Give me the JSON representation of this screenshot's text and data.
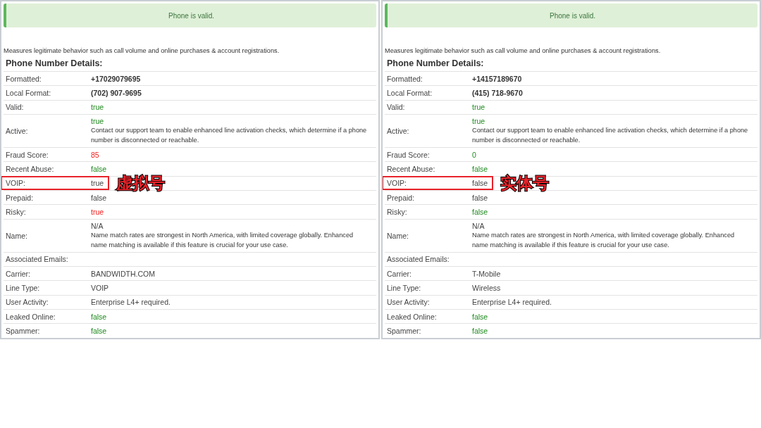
{
  "panels": [
    {
      "alert": "Phone is valid.",
      "description": "Measures legitimate behavior such as call volume and online purchases & account registrations.",
      "heading": "Phone Number Details:",
      "rows": [
        {
          "label": "Formatted:",
          "value": "+17029079695",
          "kind": "strong",
          "highlighted": false
        },
        {
          "label": "Local Format:",
          "value": "(702) 907-9695",
          "kind": "strong",
          "highlighted": false
        },
        {
          "label": "Valid:",
          "value": "true",
          "kind": "good",
          "highlighted": false
        },
        {
          "label": "Active:",
          "value": "true",
          "kind": "good",
          "note": "Contact our support team to enable enhanced line activation checks, which determine if a phone number is disconnected or reachable.",
          "highlighted": false
        },
        {
          "label": "Fraud Score:",
          "value": "85",
          "kind": "bad",
          "highlighted": false
        },
        {
          "label": "Recent Abuse:",
          "value": "false",
          "kind": "good",
          "highlighted": false
        },
        {
          "label": "VOIP:",
          "value": "true",
          "kind": "plain",
          "highlighted": true,
          "callout": "虚拟号"
        },
        {
          "label": "Prepaid:",
          "value": "false",
          "kind": "plain",
          "highlighted": false
        },
        {
          "label": "Risky:",
          "value": "true",
          "kind": "bad",
          "highlighted": false
        },
        {
          "label": "Name:",
          "value": "N/A",
          "kind": "plain",
          "note": "Name match rates are strongest in North America, with limited coverage globally. Enhanced name matching is available if this feature is crucial for your use case.",
          "highlighted": false
        },
        {
          "label": "Associated Emails:",
          "highlighted": false
        },
        {
          "label": "Carrier:",
          "value": "BANDWIDTH.COM",
          "kind": "plain",
          "highlighted": false
        },
        {
          "label": "Line Type:",
          "value": "VOIP",
          "kind": "plain",
          "highlighted": false
        },
        {
          "label": "User Activity:",
          "value": "Enterprise L4+ required.",
          "kind": "plain",
          "highlighted": false
        },
        {
          "label": "Leaked Online:",
          "value": "false",
          "kind": "good",
          "highlighted": false
        },
        {
          "label": "Spammer:",
          "value": "false",
          "kind": "good",
          "highlighted": false
        }
      ]
    },
    {
      "alert": "Phone is valid.",
      "description": "Measures legitimate behavior such as call volume and online purchases & account registrations.",
      "heading": "Phone Number Details:",
      "rows": [
        {
          "label": "Formatted:",
          "value": "+14157189670",
          "kind": "strong",
          "highlighted": false
        },
        {
          "label": "Local Format:",
          "value": "(415) 718-9670",
          "kind": "strong",
          "highlighted": false
        },
        {
          "label": "Valid:",
          "value": "true",
          "kind": "good",
          "highlighted": false
        },
        {
          "label": "Active:",
          "value": "true",
          "kind": "good",
          "note": "Contact our support team to enable enhanced line activation checks, which determine if a phone number is disconnected or reachable.",
          "highlighted": false
        },
        {
          "label": "Fraud Score:",
          "value": "0",
          "kind": "good",
          "highlighted": false
        },
        {
          "label": "Recent Abuse:",
          "value": "false",
          "kind": "good",
          "highlighted": false
        },
        {
          "label": "VOIP:",
          "value": "false",
          "kind": "plain",
          "highlighted": true,
          "callout": "实体号"
        },
        {
          "label": "Prepaid:",
          "value": "false",
          "kind": "plain",
          "highlighted": false
        },
        {
          "label": "Risky:",
          "value": "false",
          "kind": "good",
          "highlighted": false
        },
        {
          "label": "Name:",
          "value": "N/A",
          "kind": "plain",
          "note": "Name match rates are strongest in North America, with limited coverage globally. Enhanced name matching is available if this feature is crucial for your use case.",
          "highlighted": false
        },
        {
          "label": "Associated Emails:",
          "highlighted": false
        },
        {
          "label": "Carrier:",
          "value": "T-Mobile",
          "kind": "plain",
          "highlighted": false
        },
        {
          "label": "Line Type:",
          "value": "Wireless",
          "kind": "plain",
          "highlighted": false
        },
        {
          "label": "User Activity:",
          "value": "Enterprise L4+ required.",
          "kind": "plain",
          "highlighted": false
        },
        {
          "label": "Leaked Online:",
          "value": "false",
          "kind": "good",
          "highlighted": false
        },
        {
          "label": "Spammer:",
          "value": "false",
          "kind": "good",
          "highlighted": false
        }
      ]
    }
  ]
}
